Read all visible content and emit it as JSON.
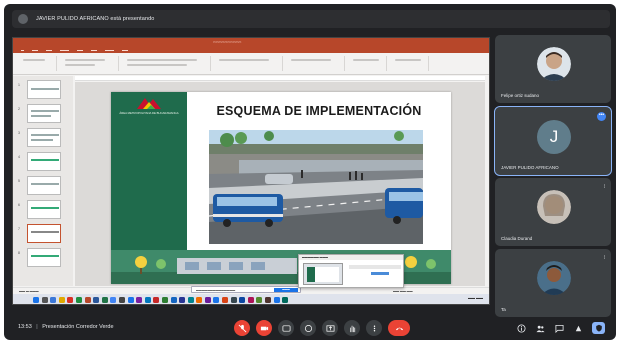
{
  "presenter": {
    "name": "JAVIER PULIDO AFRICANO está presentando"
  },
  "slide": {
    "title": "ESQUEMA DE IMPLEMENTACIÓN",
    "logo_text": "ÁREA METROPOLITANA DE BUCARAMANGA"
  },
  "participants": [
    {
      "name": "Felipe ortiz sudano"
    },
    {
      "name": "JAVIER PULIDO AFRICANO",
      "initial": "J",
      "badge": "•••"
    },
    {
      "name": "Claudia Durand"
    },
    {
      "name": "Ta"
    }
  ],
  "meeting": {
    "time": "13:53",
    "separator": "|",
    "title": "Presentación Corredor Verde"
  },
  "colors": {
    "ppt_red": "#b7472a",
    "green": "#1f6b4c",
    "meet_bg": "#202124",
    "hangup": "#ea4335",
    "accent": "#8ab4f8"
  },
  "icons": [
    "mic-off-icon",
    "camera-icon",
    "captions-icon",
    "emoji-icon",
    "present-icon",
    "raise-hand-icon",
    "more-icon",
    "hangup-icon",
    "info-icon",
    "people-icon",
    "chat-icon",
    "activities-icon",
    "host-controls-icon"
  ]
}
